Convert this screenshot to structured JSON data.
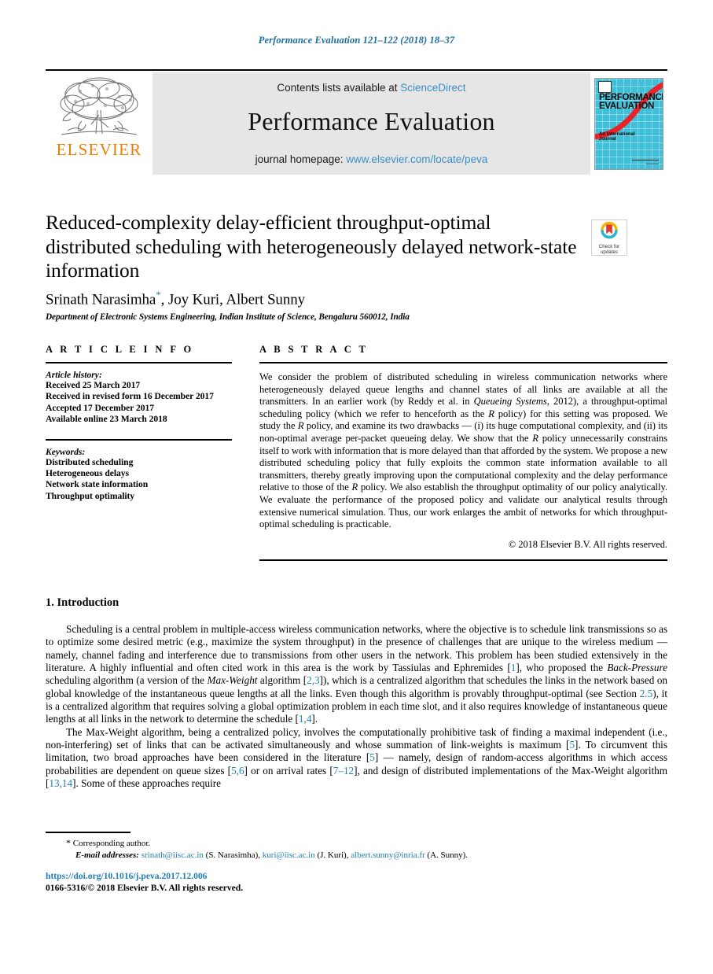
{
  "running_head": "Performance Evaluation 121–122 (2018) 18–37",
  "masthead": {
    "publisher_name": "ELSEVIER",
    "contents_prefix": "Contents lists available at",
    "contents_link": "ScienceDirect",
    "journal_name": "Performance Evaluation",
    "homepage_prefix": "journal homepage:",
    "homepage_link": "www.elsevier.com/locate/peva",
    "cover": {
      "title_line1": "PERFORMANCE",
      "title_line2": "EVALUATION",
      "subtitle_line1": "An International",
      "subtitle_line2": "Journal",
      "footer_text": "ScienceDirect",
      "background_color": "#3fc0d8",
      "curve_color": "#e8232a"
    },
    "link_color": "#3a8ec4",
    "elsevier_color": "#f07d00"
  },
  "article": {
    "title": "Reduced-complexity delay-efficient throughput-optimal distributed scheduling with heterogeneously delayed network-state information",
    "authors": "Srinath Narasimha",
    "authors_rest": ", Joy Kuri, Albert Sunny",
    "corresponding_marker": "*",
    "affiliation": "Department of Electronic Systems Engineering, Indian Institute of Science, Bengaluru 560012, India"
  },
  "crossmark": {
    "line1": "Check for",
    "line2": "updates"
  },
  "article_info": {
    "heading": "A R T I C L E   I N F O",
    "history_label": "Article history:",
    "history": [
      "Received 25 March 2017",
      "Received in revised form 16 December 2017",
      "Accepted 17 December 2017",
      "Available online 23 March 2018"
    ],
    "keywords_label": "Keywords:",
    "keywords": [
      "Distributed scheduling",
      "Heterogeneous delays",
      "Network state information",
      "Throughput optimality"
    ]
  },
  "abstract": {
    "heading": "A B S T R A C T",
    "p1_a": "We consider the problem of distributed scheduling in wireless communication networks where heterogeneously delayed queue lengths and channel states of all links are available at all the transmitters. In an earlier work (by Reddy et al. in ",
    "p1_em1": "Queueing Systems",
    "p1_b": ", 2012), a throughput-optimal scheduling policy (which we refer to henceforth as the ",
    "p1_em2": "R",
    "p1_c": " policy) for this setting was proposed. We study the ",
    "p1_em3": "R",
    "p1_d": " policy, and examine its two drawbacks — (i) its huge computational complexity, and (ii) its non-optimal average per-packet queueing delay. We show that the ",
    "p1_em4": "R",
    "p1_e": " policy unnecessarily constrains itself to work with information that is more delayed than that afforded by the system. We propose a new distributed scheduling policy that fully exploits the common state information available to all transmitters, thereby greatly improving upon the computational complexity and the delay performance relative to those of the ",
    "p1_em5": "R",
    "p1_f": " policy. We also establish the throughput optimality of our policy analytically. We evaluate the performance of the proposed policy and validate our analytical results through extensive numerical simulation. Thus, our work enlarges the ambit of networks for which throughput-optimal scheduling is practicable.",
    "copyright": "© 2018 Elsevier B.V. All rights reserved."
  },
  "section1": {
    "title": "1. Introduction",
    "p1_a": "Scheduling is a central problem in multiple-access wireless communication networks, where the objective is to schedule link transmissions so as to optimize some desired metric (e.g., maximize the system throughput) in the presence of challenges that are unique to the wireless medium — namely, channel fading and interference due to transmissions from other users in the network. This problem has been studied extensively in the literature. A highly influential and often cited work in this area is the work by Tassiulas and Ephremides [",
    "p1_ref1": "1",
    "p1_b": "], who proposed the ",
    "p1_em1": "Back-Pressure",
    "p1_c": " scheduling algorithm (a version of the ",
    "p1_em2": "Max-Weight",
    "p1_d": " algorithm [",
    "p1_ref2": "2,3",
    "p1_e": "]), which is a centralized algorithm that schedules the links in the network based on global knowledge of the instantaneous queue lengths at all the links. Even though this algorithm is provably throughput-optimal (see Section ",
    "p1_ref3": "2.5",
    "p1_f": "), it is a centralized algorithm that requires solving a global optimization problem in each time slot, and it also requires knowledge of instantaneous queue lengths at all links in the network to determine the schedule [",
    "p1_ref4": "1,4",
    "p1_g": "].",
    "p2_a": "The Max-Weight algorithm, being a centralized policy, involves the computationally prohibitive task of finding a maximal independent (i.e., non-interfering) set of links that can be activated simultaneously and whose summation of link-weights is maximum [",
    "p2_ref1": "5",
    "p2_b": "]. To circumvent this limitation, two broad approaches have been considered in the literature [",
    "p2_ref2": "5",
    "p2_c": "] — namely, design of random-access algorithms in which access probabilities are dependent on queue sizes [",
    "p2_ref3": "5,6",
    "p2_d": "] or on arrival rates [",
    "p2_ref4": "7–12",
    "p2_e": "], and design of distributed implementations of the Max-Weight algorithm [",
    "p2_ref5": "13,14",
    "p2_f": "]. Some of these approaches require"
  },
  "footnotes": {
    "corresponding_marker": "*",
    "corresponding_text": "Corresponding author.",
    "email_label": "E-mail addresses:",
    "emails": [
      {
        "address": "srinath@iisc.ac.in",
        "person": "(S. Narasimha),"
      },
      {
        "address": "kuri@iisc.ac.in",
        "person": "(J. Kuri),"
      },
      {
        "address": "albert.sunny@inria.fr",
        "person": "(A. Sunny)."
      }
    ]
  },
  "footer": {
    "doi": "https://doi.org/10.1016/j.peva.2017.12.006",
    "issn": "0166-5316/© 2018 Elsevier B.V. All rights reserved."
  }
}
